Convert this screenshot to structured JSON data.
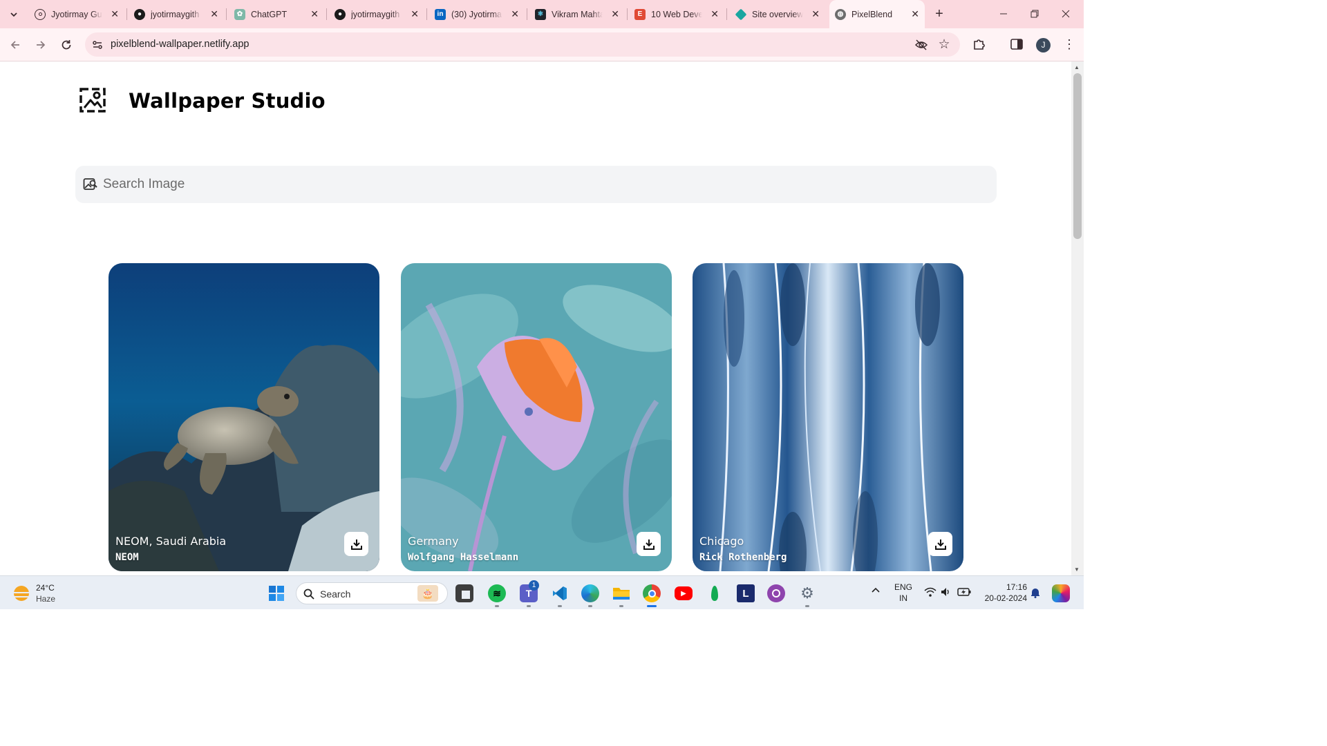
{
  "browser": {
    "tabs": [
      {
        "title": "Jyotirmay Gu",
        "icon": "account-circle-icon"
      },
      {
        "title": "jyotirmaygith",
        "icon": "github-icon"
      },
      {
        "title": "ChatGPT",
        "icon": "chatgpt-icon"
      },
      {
        "title": "jyotirmaygith",
        "icon": "github-icon"
      },
      {
        "title": "(30) Jyotirma",
        "icon": "linkedin-icon"
      },
      {
        "title": "Vikram Mahta",
        "icon": "react-icon"
      },
      {
        "title": "10 Web Deve",
        "icon": "bookmark-icon"
      },
      {
        "title": "Site overview",
        "icon": "netlify-icon"
      },
      {
        "title": "PixelBlend",
        "icon": "globe-icon",
        "active": true
      }
    ],
    "url": "pixelblend-wallpaper.netlify.app",
    "profile_initial": "J"
  },
  "app": {
    "title": "Wallpaper Studio",
    "search_placeholder": "Search Image"
  },
  "gallery": [
    {
      "location": "NEOM, Saudi Arabia",
      "author": "NEOM",
      "image": "sea turtle over coral reef"
    },
    {
      "location": "Germany",
      "author": "Wolfgang Hasselmann",
      "image": "orange poppy flower"
    },
    {
      "location": "Chicago",
      "author": "Rick Rothenberg",
      "image": "blue abstract waves"
    }
  ],
  "taskbar": {
    "weather_temp": "24°C",
    "weather_desc": "Haze",
    "search_label": "Search",
    "teams_badge": "1",
    "language": "ENG",
    "region": "IN",
    "time": "17:16",
    "date": "20-02-2024"
  },
  "colors": {
    "tabstrip": "#fbd9df",
    "toolbar": "#fff3f5",
    "search_bg": "#f3f4f6"
  }
}
